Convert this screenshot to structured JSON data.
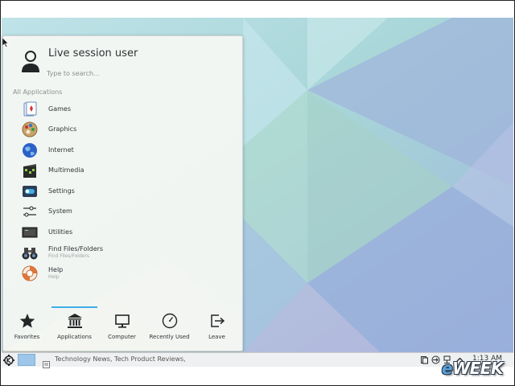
{
  "user": {
    "name": "Live session user",
    "avatar_icon": "user-avatar-icon"
  },
  "search": {
    "placeholder": "Type to search..."
  },
  "section": {
    "label": "All Applications"
  },
  "apps": [
    {
      "label": "Games",
      "sub": "",
      "icon": "games-icon"
    },
    {
      "label": "Graphics",
      "sub": "",
      "icon": "graphics-icon"
    },
    {
      "label": "Internet",
      "sub": "",
      "icon": "internet-globe-icon"
    },
    {
      "label": "Multimedia",
      "sub": "",
      "icon": "multimedia-icon"
    },
    {
      "label": "Settings",
      "sub": "",
      "icon": "settings-toggle-icon"
    },
    {
      "label": "System",
      "sub": "",
      "icon": "system-sliders-icon"
    },
    {
      "label": "Utilities",
      "sub": "",
      "icon": "utilities-icon"
    },
    {
      "label": "Find Files/Folders",
      "sub": "Find Files/Folders",
      "icon": "binoculars-icon"
    },
    {
      "label": "Help",
      "sub": "Help",
      "icon": "lifebuoy-icon"
    }
  ],
  "tabs": [
    {
      "label": "Favorites",
      "icon": "star-icon"
    },
    {
      "label": "Applications",
      "icon": "applications-building-icon",
      "active": true
    },
    {
      "label": "Computer",
      "icon": "computer-monitor-icon"
    },
    {
      "label": "Recently Used",
      "icon": "clock-icon"
    },
    {
      "label": "Leave",
      "icon": "leave-exit-icon"
    }
  ],
  "taskbar": {
    "task_label": "Technology News, Tech Product Reviews, R",
    "clock": "1:13 AM"
  },
  "watermark": {
    "prefix": "e",
    "text": "WEEK"
  },
  "colors": {
    "accent": "#3daee9",
    "pager": "#9dc6e8",
    "panel": "#eff0f1"
  }
}
